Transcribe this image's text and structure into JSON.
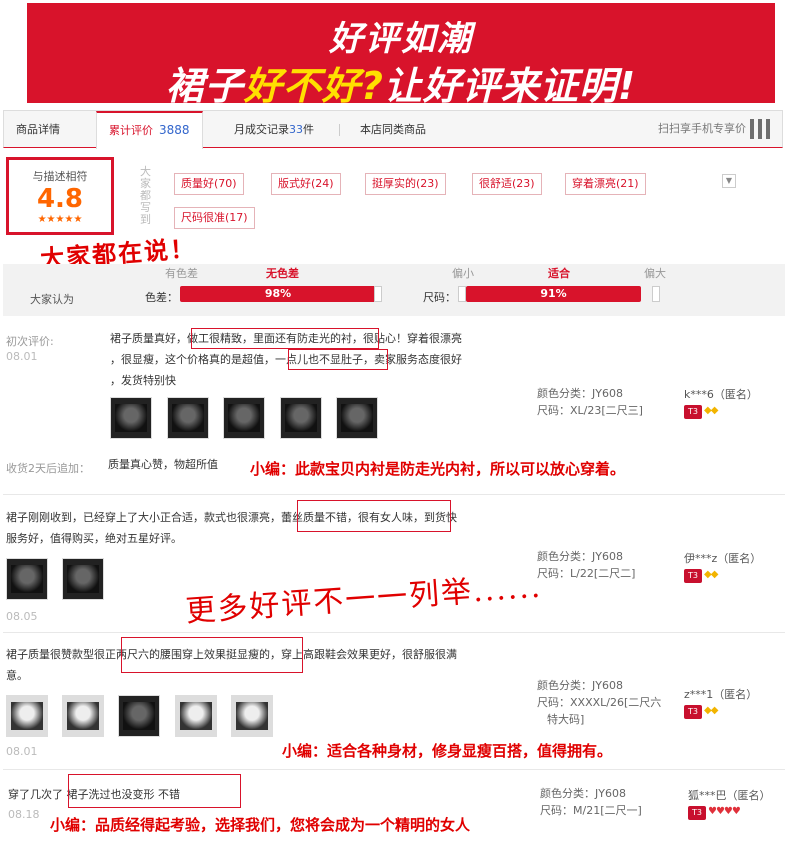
{
  "banner": {
    "line1": "好评如潮",
    "line2a": "裙子",
    "line2b": "好不好?",
    "line2c": "让好评来证明!"
  },
  "tabs": {
    "detail": "商品详情",
    "reviews": "累计评价",
    "reviews_count": "3888",
    "monthly": "月成交记录",
    "monthly_count": "33",
    "monthly_unit": "件",
    "same": "本店同类商品",
    "mobile": "扫扫享手机专享价"
  },
  "score": {
    "label": "与描述相符",
    "value": "4.8",
    "stars": "★★★★★"
  },
  "sidebar_vertical": "大家都写到",
  "tags": [
    "质量好(70)",
    "版式好(24)",
    "挺厚实的(23)",
    "很舒适(23)",
    "穿着漂亮(21)",
    "尺码很准(17)"
  ],
  "annotation_say": "大家都在说！",
  "opinion": {
    "label": "大家认为",
    "color": {
      "label": "色差：",
      "left": "有色差",
      "mid": "无色差",
      "percent": "98%",
      "fill": 0.98
    },
    "size": {
      "label": "尺码：",
      "left": "偏小",
      "mid": "适合",
      "right": "偏大",
      "percent": "91%",
      "fill": 0.91
    }
  },
  "reviews": [
    {
      "first_label": "初次评价:",
      "date": "08.01",
      "text_lines": [
        "裙子质量真好，做工很精致，里面还有防走光的衬，很贴心！穿着很漂亮",
        "，很显瘦，这个价格真的是超值，一点儿也不显肚子，卖家服务态度很好",
        "，发货特别快"
      ],
      "color": "颜色分类：JY608",
      "size": "尺码：XL/23[二尺三]",
      "user": "k***6（匿名）",
      "followup_label": "收货2天后追加：",
      "followup": "质量真心赞，物超所值"
    },
    {
      "text_lines": [
        "裙子刚刚收到，已经穿上了大小正合适，款式也很漂亮，蕾丝质量不错，很有女人味，到货快",
        "服务好，值得购买，绝对五星好评。"
      ],
      "date": "08.05",
      "color": "颜色分类：JY608",
      "size": "尺码：L/22[二尺二]",
      "user": "伊***z（匿名）"
    },
    {
      "text_lines": [
        "裙子质量很赞款型很正两尺六的腰围穿上效果挺显瘦的，穿上高跟鞋会效果更好，很舒服很满",
        "意。"
      ],
      "date": "08.01",
      "color": "颜色分类：JY608",
      "size_line1": "尺码：XXXXL/26[二尺六",
      "size_line2": "特大码]",
      "user": "z***1（匿名）"
    },
    {
      "text": "穿了几次了 裙子洗过也没变形 不错",
      "date": "08.18",
      "color": "颜色分类：JY608",
      "size": "尺码：M/21[二尺一]",
      "user": "狐***巴（匿名）"
    }
  ],
  "editor_notes": [
    "小编：此款宝贝内衬是防走光内衬，所以可以放心穿着。",
    "小编：适合各种身材，修身显瘦百搭，值得拥有。",
    "小编：品质经得起考验，选择我们，您将会成为一个精明的女人"
  ],
  "more_note": "更多好评不一一列举......",
  "badge_text": "T3"
}
